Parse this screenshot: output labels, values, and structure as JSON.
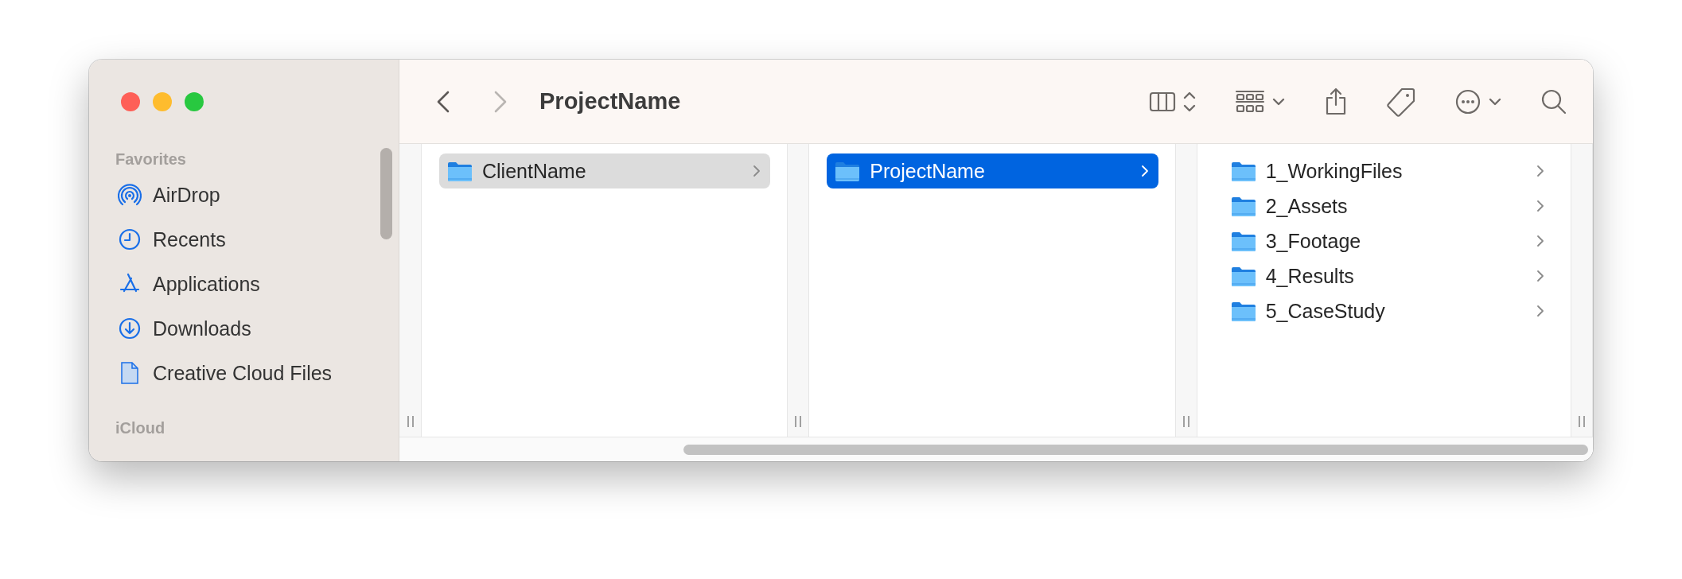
{
  "window": {
    "title": "ProjectName"
  },
  "navigation": [
    {
      "kind": "back",
      "disabled": false
    },
    {
      "kind": "forward",
      "disabled": true
    }
  ],
  "toolbar_buttons": [
    {
      "kind": "view",
      "menu": true
    },
    {
      "kind": "group",
      "menu": true
    },
    {
      "kind": "share",
      "menu": false
    },
    {
      "kind": "tag",
      "menu": false
    },
    {
      "kind": "more",
      "menu": true
    },
    {
      "kind": "search",
      "menu": false
    }
  ],
  "sidebar": {
    "sections": [
      {
        "title": "Favorites",
        "items": [
          {
            "label": "AirDrop",
            "kind": "airdrop"
          },
          {
            "label": "Recents",
            "kind": "recents"
          },
          {
            "label": "Applications",
            "kind": "applications"
          },
          {
            "label": "Downloads",
            "kind": "downloads"
          },
          {
            "label": "Creative Cloud Files",
            "kind": "document"
          }
        ]
      },
      {
        "title": "iCloud"
      }
    ]
  },
  "columns": [
    {
      "focused": false,
      "items": [
        {
          "label": "ClientName",
          "selected": true
        }
      ]
    },
    {
      "focused": true,
      "items": [
        {
          "label": "ProjectName",
          "selected": true
        }
      ]
    },
    {
      "items": [
        {
          "label": "1_WorkingFiles",
          "selected": false
        },
        {
          "label": "2_Assets",
          "selected": false
        },
        {
          "label": "3_Footage",
          "selected": false
        },
        {
          "label": "4_Results",
          "selected": false
        },
        {
          "label": "5_CaseStudy",
          "selected": false
        }
      ]
    }
  ]
}
